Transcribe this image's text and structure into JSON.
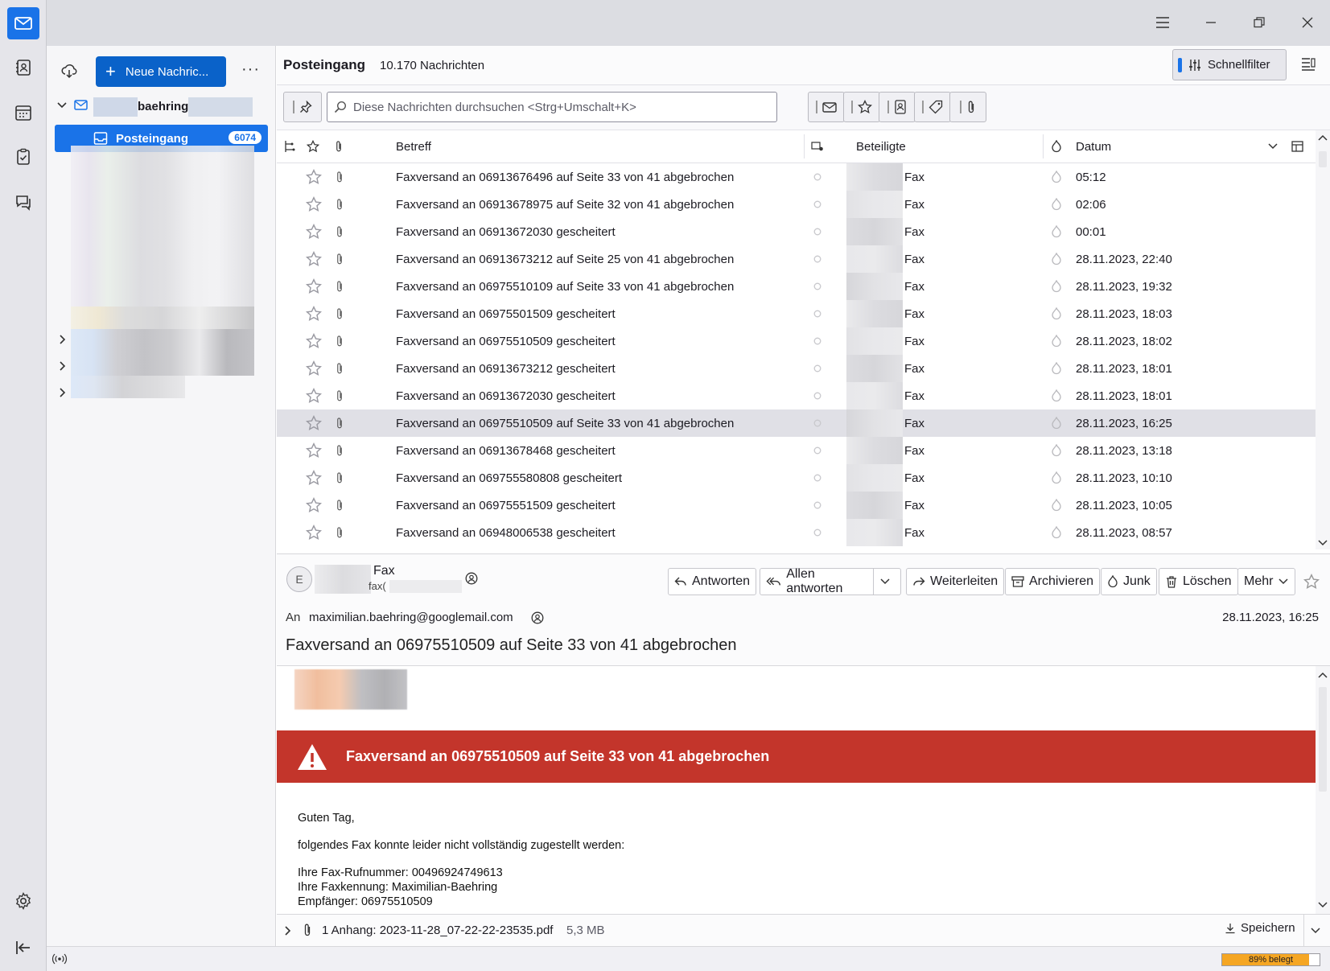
{
  "title_bar": {
    "menu_icon": "hamburger-icon",
    "minimize_icon": "minimize-icon",
    "restore_icon": "restore-icon",
    "close_icon": "close-icon"
  },
  "spaces": [
    "mail-icon",
    "address-book-icon",
    "calendar-icon",
    "tasks-icon",
    "chat-icon"
  ],
  "folder_pane": {
    "new_message_label": "Neue Nachric...",
    "account_name": "baehring",
    "inbox_label": "Posteingang",
    "inbox_count": "6074"
  },
  "list": {
    "folder_title": "Posteingang",
    "message_count": "10.170 Nachrichten",
    "quick_filter_label": "Schnellfilter",
    "search_placeholder": "Diese Nachrichten durchsuchen <Strg+Umschalt+K>",
    "columns": {
      "subject": "Betreff",
      "correspondents": "Beteiligte",
      "date": "Datum"
    },
    "rows": [
      {
        "subject": "Faxversand an 06913676496 auf Seite 33 von 41 abgebrochen",
        "from": "Fax",
        "date": "05:12"
      },
      {
        "subject": "Faxversand an 06913678975 auf Seite 32 von 41 abgebrochen",
        "from": "Fax",
        "date": "02:06"
      },
      {
        "subject": "Faxversand an 06913672030 gescheitert",
        "from": "Fax",
        "date": "00:01"
      },
      {
        "subject": "Faxversand an 06913673212 auf Seite 25 von 41 abgebrochen",
        "from": "Fax",
        "date": "28.11.2023, 22:40"
      },
      {
        "subject": "Faxversand an 06975510109 auf Seite 33 von 41 abgebrochen",
        "from": "Fax",
        "date": "28.11.2023, 19:32"
      },
      {
        "subject": "Faxversand an 06975501509 gescheitert",
        "from": "Fax",
        "date": "28.11.2023, 18:03"
      },
      {
        "subject": "Faxversand an 06975510509 gescheitert",
        "from": "Fax",
        "date": "28.11.2023, 18:02"
      },
      {
        "subject": "Faxversand an 06913673212 gescheitert",
        "from": "Fax",
        "date": "28.11.2023, 18:01"
      },
      {
        "subject": "Faxversand an 06913672030 gescheitert",
        "from": "Fax",
        "date": "28.11.2023, 18:01"
      },
      {
        "subject": "Faxversand an 06975510509 auf Seite 33 von 41 abgebrochen",
        "from": "Fax",
        "date": "28.11.2023, 16:25",
        "selected": true
      },
      {
        "subject": "Faxversand an 06913678468 gescheitert",
        "from": "Fax",
        "date": "28.11.2023, 13:18"
      },
      {
        "subject": "Faxversand an 069755580808 gescheitert",
        "from": "Fax",
        "date": "28.11.2023, 10:10"
      },
      {
        "subject": "Faxversand an 06975551509 gescheitert",
        "from": "Fax",
        "date": "28.11.2023, 10:05"
      },
      {
        "subject": "Faxversand an 06948006538 gescheitert",
        "from": "Fax",
        "date": "28.11.2023, 08:57"
      }
    ]
  },
  "message": {
    "avatar_letter": "E",
    "from_name": "Fax",
    "from_email": "fax(",
    "buttons": {
      "reply": "Antworten",
      "reply_all": "Allen antworten",
      "forward": "Weiterleiten",
      "archive": "Archivieren",
      "junk": "Junk",
      "delete": "Löschen",
      "more": "Mehr"
    },
    "to_label": "An",
    "to_address": "maximilian.baehring@googlemail.com",
    "date": "28.11.2023, 16:25",
    "subject": "Faxversand an 06975510509 auf Seite 33 von 41 abgebrochen",
    "banner_text": "Faxversand an 06975510509 auf Seite 33 von 41 abgebrochen",
    "body": {
      "greeting": "Guten Tag,",
      "line1": "folgendes Fax konnte leider nicht vollständig zugestellt werden:",
      "fax_number": "Ihre Fax-Rufnummer: 00496924749613",
      "fax_id": "Ihre Faxkennung: Maximilian-Baehring",
      "recipient": "Empfänger: 06975510509"
    }
  },
  "attachment": {
    "label": "1 Anhang: 2023-11-28_07-22-22-23535.pdf",
    "size": "5,3 MB",
    "save_label": "Speichern"
  },
  "status": {
    "quota_text": "89% belegt",
    "quota_fraction": 0.89
  },
  "colors": {
    "accent": "#0a62c9",
    "inbox_highlight": "#1a73e8",
    "banner": "#c3352b",
    "quota": "#f5a623"
  }
}
